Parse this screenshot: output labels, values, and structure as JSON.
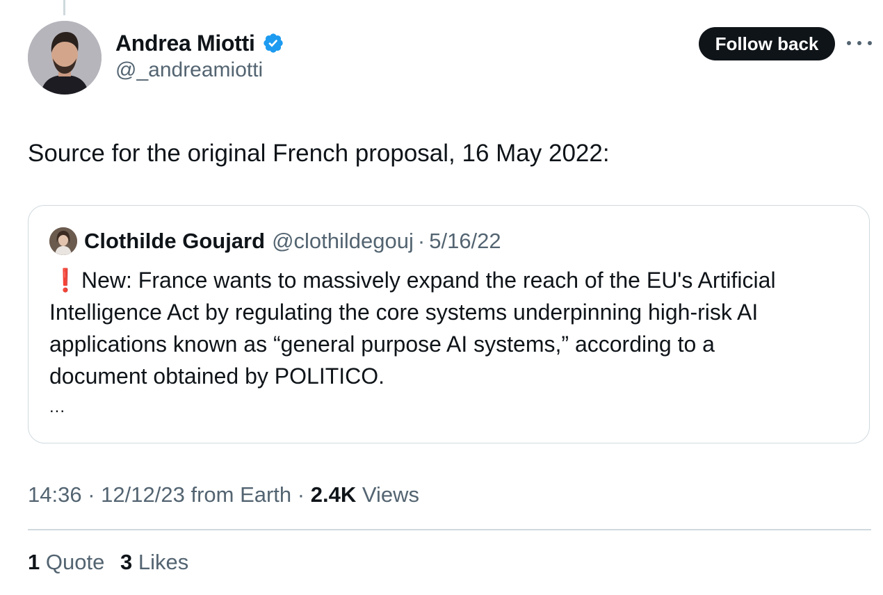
{
  "author": {
    "display_name": "Andrea Miotti",
    "handle": "@_andreamiotti",
    "verified": true,
    "verified_color": "#1d9bf0"
  },
  "actions": {
    "follow_label": "Follow back"
  },
  "tweet": {
    "text": "Source for the original French proposal, 16 May 2022:"
  },
  "quoted": {
    "display_name": "Clothilde Goujard",
    "handle": "@clothildegouj",
    "separator": "·",
    "date": "5/16/22",
    "alert_icon": "❗",
    "lines": [
      "New: France wants to massively expand the reach of the EU's Artificial",
      "Intelligence Act by regulating the core systems underpinning high-risk AI",
      "applications known as “general purpose AI systems,” according to a",
      "document obtained by POLITICO."
    ],
    "more": "..."
  },
  "meta": {
    "time": "14:36",
    "sep1": "·",
    "date": "12/12/23",
    "source": "from Earth",
    "sep2": "·",
    "views_count": "2.4K",
    "views_label": "Views"
  },
  "stats": {
    "quotes_count": "1",
    "quotes_label": "Quote",
    "likes_count": "3",
    "likes_label": "Likes"
  },
  "colors": {
    "text": "#0f1419",
    "secondary": "#536471",
    "border": "#cfd9de",
    "alert": "#e0245e"
  }
}
